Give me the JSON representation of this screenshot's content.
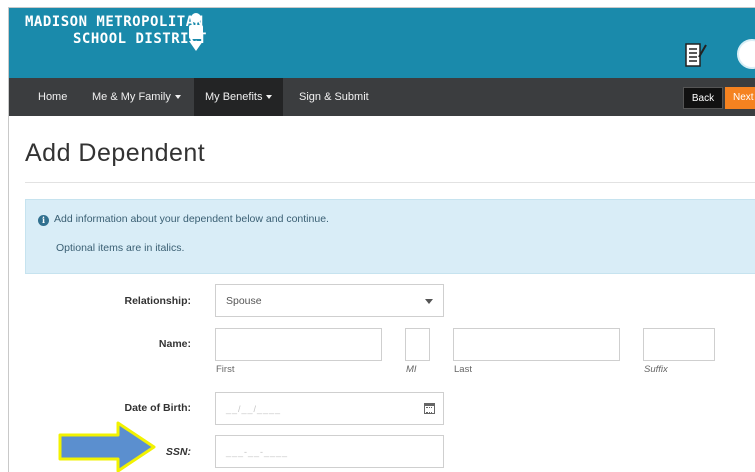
{
  "header": {
    "brand_line1": "MADISON METROPOLITAN",
    "brand_line2": "SCHOOL DISTRICT",
    "colors": {
      "brand_bar": "#1a8aab",
      "nav": "#3b3d3f",
      "next": "#f58220"
    }
  },
  "nav": {
    "items": [
      {
        "label": "Home",
        "has_dropdown": false,
        "active": false
      },
      {
        "label": "Me & My Family",
        "has_dropdown": true,
        "active": false
      },
      {
        "label": "My Benefits",
        "has_dropdown": true,
        "active": true
      },
      {
        "label": "Sign & Submit",
        "has_dropdown": false,
        "active": false
      }
    ],
    "back_label": "Back",
    "next_label": "Next"
  },
  "page": {
    "title": "Add Dependent"
  },
  "alert": {
    "icon": "info-icon",
    "line1": "Add information about your dependent below and continue.",
    "line2": "Optional items are in italics."
  },
  "form": {
    "relationship": {
      "label": "Relationship:",
      "value": "Spouse"
    },
    "name": {
      "label": "Name:",
      "first_sub": "First",
      "mi_sub": "MI",
      "last_sub": "Last",
      "suffix_sub": "Suffix"
    },
    "dob": {
      "label": "Date of Birth:",
      "placeholder": "__/__/____"
    },
    "ssn": {
      "label": "SSN:",
      "placeholder": "___-__-____"
    }
  }
}
